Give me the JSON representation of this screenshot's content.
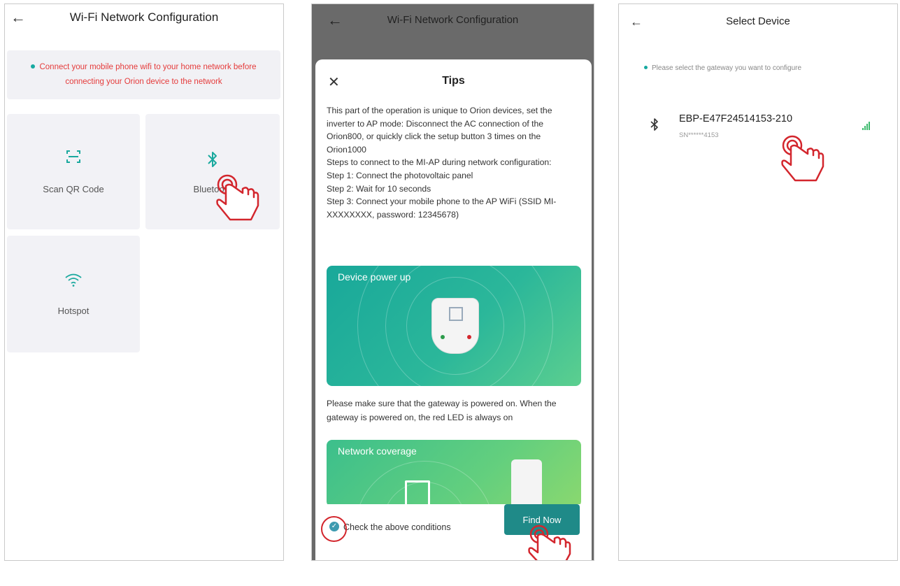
{
  "screen1": {
    "back_icon": "arrow-left-icon",
    "title": "Wi-Fi Network Configuration",
    "notice": "Connect your mobile phone wifi to your home network before connecting your Orion device to the network",
    "options": [
      {
        "label": "Scan QR Code",
        "icon": "scan-qr-icon"
      },
      {
        "label": "Bluetooth",
        "icon": "bluetooth-icon"
      },
      {
        "label": "Hotspot",
        "icon": "wifi-icon"
      }
    ]
  },
  "screen2": {
    "title": "Wi-Fi Network Configuration",
    "sheet_title": "Tips",
    "close_icon": "close-icon",
    "tips_lines": [
      "This part of the operation is unique to Orion devices, set the inverter to AP mode: Disconnect the AC connection of the Orion800, or quickly click the setup button 3 times on the Orion1000",
      "Steps to connect to the MI-AP during network configuration:",
      "Step 1: Connect the photovoltaic panel",
      "Step 2: Wait for 10 seconds",
      "Step 3: Connect your mobile phone to the AP WiFi (SSID MI-XXXXXXXX, password: 12345678)"
    ],
    "image1_caption": "Device power up",
    "image1_note": "Please make sure that the gateway is powered on. When the gateway is powered on, the red LED is always on",
    "image2_caption": "Network coverage",
    "check_label": "Check the above conditions",
    "find_button": "Find Now"
  },
  "screen3": {
    "title": "Select Device",
    "hint": "Please select the gateway you want to configure",
    "device_name": "EBP-E47F24514153-210",
    "device_sn": "SN******4153",
    "device_icon": "bluetooth-icon",
    "signal_icon": "signal-strength-icon"
  },
  "colors": {
    "accent": "#1aa99e",
    "warning_text": "#e53b3b",
    "primary_button": "#1f8a88",
    "annotation": "#d3262d"
  }
}
